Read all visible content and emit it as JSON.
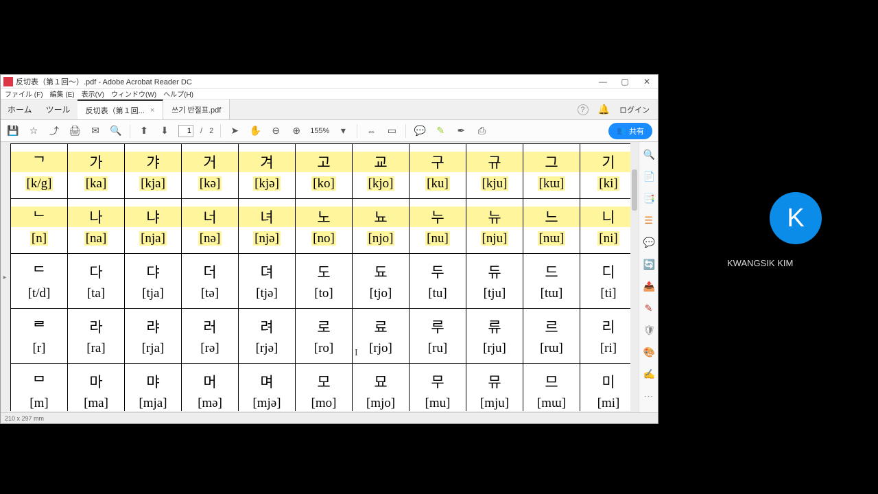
{
  "window": {
    "title": "反切表（第１回～）.pdf - Adobe Acrobat Reader DC",
    "minimize": "—",
    "maximize": "▢",
    "close": "✕"
  },
  "menus": [
    "ファイル (F)",
    "編集 (E)",
    "表示(V)",
    "ウィンドウ(W)",
    "ヘルプ(H)"
  ],
  "primary_tabs": {
    "home": "ホーム",
    "tools": "ツール"
  },
  "doc_tabs": [
    {
      "label": "反切表（第１回...",
      "close": "×",
      "active": true
    },
    {
      "label": "쓰기 반절표.pdf",
      "close": "",
      "active": false
    }
  ],
  "tab_right": {
    "help": "?",
    "bell": "🔔",
    "login": "ログイン"
  },
  "toolbar": {
    "page_current": "1",
    "page_sep": "/",
    "page_total": "2",
    "zoom": "155%",
    "share": "共有"
  },
  "status": {
    "dim": "210 x 297 mm"
  },
  "avatar": {
    "letter": "K",
    "name": "KWANGSIK KIM"
  },
  "table": [
    [
      {
        "k": "ᄀ",
        "p": "[k/g]",
        "hl": true
      },
      {
        "k": "가",
        "p": "[ka]",
        "hl": true
      },
      {
        "k": "갸",
        "p": "[kja]",
        "hl": true
      },
      {
        "k": "거",
        "p": "[kə]",
        "hl": true
      },
      {
        "k": "겨",
        "p": "[kjə]",
        "hl": true
      },
      {
        "k": "고",
        "p": "[ko]",
        "hl": true
      },
      {
        "k": "교",
        "p": "[kjo]",
        "hl": true
      },
      {
        "k": "구",
        "p": "[ku]",
        "hl": true
      },
      {
        "k": "규",
        "p": "[kju]",
        "hl": true
      },
      {
        "k": "그",
        "p": "[kɯ]",
        "hl": true
      },
      {
        "k": "기",
        "p": "[ki]",
        "hl": true
      }
    ],
    [
      {
        "k": "ᄂ",
        "p": "[n]",
        "hl": true
      },
      {
        "k": "나",
        "p": "[na]",
        "hl": true
      },
      {
        "k": "냐",
        "p": "[nja]",
        "hl": true
      },
      {
        "k": "너",
        "p": "[nə]",
        "hl": true
      },
      {
        "k": "녀",
        "p": "[njə]",
        "hl": true
      },
      {
        "k": "노",
        "p": "[no]",
        "hl": true
      },
      {
        "k": "뇨",
        "p": "[njo]",
        "hl": true
      },
      {
        "k": "누",
        "p": "[nu]",
        "hl": true
      },
      {
        "k": "뉴",
        "p": "[nju]",
        "hl": true
      },
      {
        "k": "느",
        "p": "[nɯ]",
        "hl": true
      },
      {
        "k": "니",
        "p": "[ni]",
        "hl": true
      }
    ],
    [
      {
        "k": "ᄃ",
        "p": "[t/d]"
      },
      {
        "k": "다",
        "p": "[ta]"
      },
      {
        "k": "댜",
        "p": "[tja]"
      },
      {
        "k": "더",
        "p": "[tə]"
      },
      {
        "k": "뎌",
        "p": "[tjə]"
      },
      {
        "k": "도",
        "p": "[to]"
      },
      {
        "k": "됴",
        "p": "[tjo]"
      },
      {
        "k": "두",
        "p": "[tu]"
      },
      {
        "k": "듀",
        "p": "[tju]"
      },
      {
        "k": "드",
        "p": "[tɯ]"
      },
      {
        "k": "디",
        "p": "[ti]"
      }
    ],
    [
      {
        "k": "ᄅ",
        "p": "[r]"
      },
      {
        "k": "라",
        "p": "[ra]"
      },
      {
        "k": "랴",
        "p": "[rja]"
      },
      {
        "k": "러",
        "p": "[rə]"
      },
      {
        "k": "려",
        "p": "[rjə]"
      },
      {
        "k": "로",
        "p": "[ro]"
      },
      {
        "k": "료",
        "p": "[rjo]"
      },
      {
        "k": "루",
        "p": "[ru]"
      },
      {
        "k": "류",
        "p": "[rju]"
      },
      {
        "k": "르",
        "p": "[rɯ]"
      },
      {
        "k": "리",
        "p": "[ri]"
      }
    ],
    [
      {
        "k": "ᄆ",
        "p": "[m]"
      },
      {
        "k": "마",
        "p": "[ma]"
      },
      {
        "k": "먀",
        "p": "[mja]"
      },
      {
        "k": "머",
        "p": "[mə]"
      },
      {
        "k": "며",
        "p": "[mjə]"
      },
      {
        "k": "모",
        "p": "[mo]"
      },
      {
        "k": "묘",
        "p": "[mjo]"
      },
      {
        "k": "무",
        "p": "[mu]"
      },
      {
        "k": "뮤",
        "p": "[mju]"
      },
      {
        "k": "므",
        "p": "[mɯ]"
      },
      {
        "k": "미",
        "p": "[mi]"
      }
    ]
  ],
  "right_tools": [
    {
      "c": "#888"
    },
    {
      "c": "#c0392b"
    },
    {
      "c": "#c0392b"
    },
    {
      "c": "#e67e22"
    },
    {
      "c": "#f1c40f"
    },
    {
      "c": "#8e44ad"
    },
    {
      "c": "#27ae60"
    },
    {
      "c": "#c0392b"
    },
    {
      "c": "#888"
    },
    {
      "c": "#16a085"
    },
    {
      "c": "#c0392b"
    },
    {
      "c": "#888"
    }
  ]
}
